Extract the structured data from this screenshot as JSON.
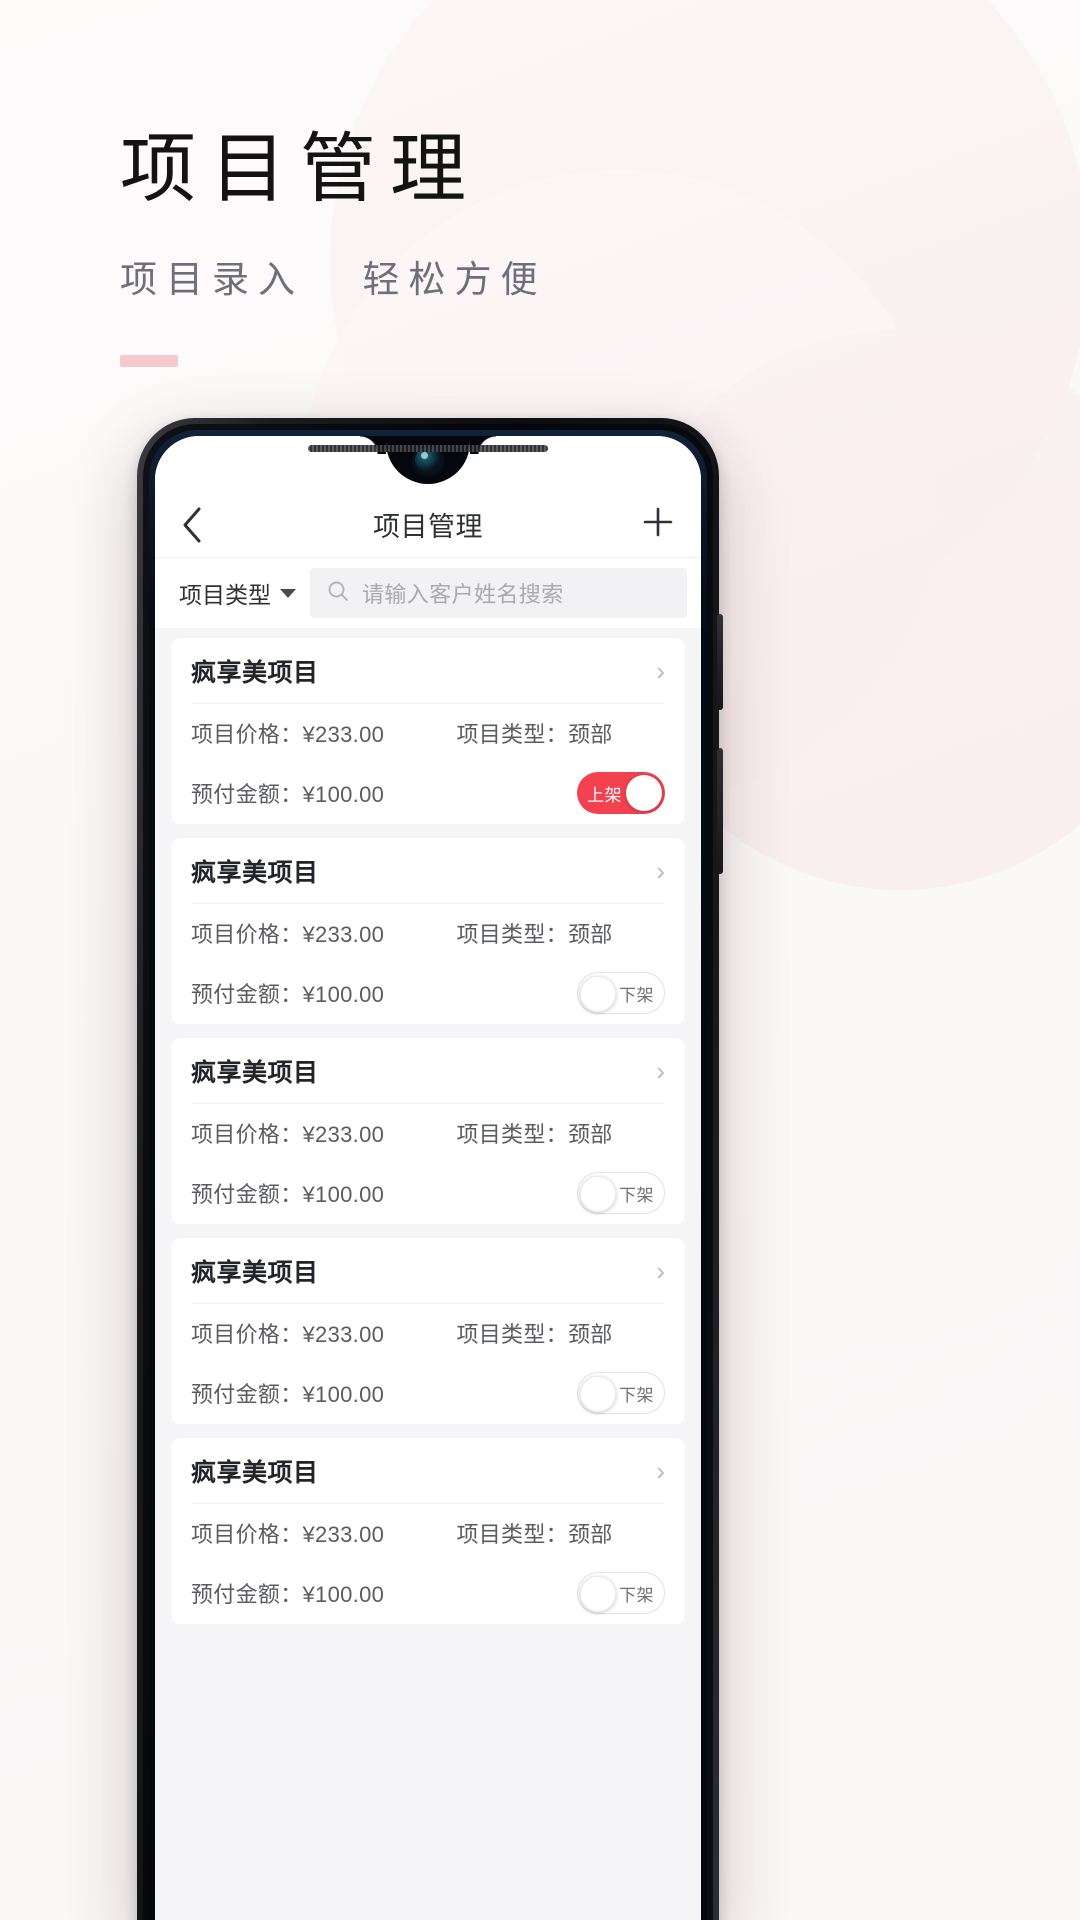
{
  "promo": {
    "headline": "项目管理",
    "subhead_left": "项目录入",
    "subhead_right": "轻松方便",
    "accent_color": "#f6c9cf"
  },
  "app": {
    "navbar": {
      "back_icon": "chevron-left-icon",
      "title": "项目管理",
      "add_icon": "plus-icon"
    },
    "filterbar": {
      "type_filter_label": "项目类型",
      "type_filter_caret": "chevron-down-icon",
      "search_icon": "search-icon",
      "search_placeholder": "请输入客户姓名搜索",
      "search_value": ""
    },
    "labels": {
      "price": "项目价格：",
      "type": "项目类型：",
      "prepay": "预付金额：",
      "chevron": "›"
    },
    "accent_on_color": "#f2414f",
    "cards": [
      {
        "title": "疯享美项目",
        "price": "¥233.00",
        "type": "颈部",
        "prepay": "¥100.00",
        "status_label": "上架",
        "status_on": true
      },
      {
        "title": "疯享美项目",
        "price": "¥233.00",
        "type": "颈部",
        "prepay": "¥100.00",
        "status_label": "下架",
        "status_on": false
      },
      {
        "title": "疯享美项目",
        "price": "¥233.00",
        "type": "颈部",
        "prepay": "¥100.00",
        "status_label": "下架",
        "status_on": false
      },
      {
        "title": "疯享美项目",
        "price": "¥233.00",
        "type": "颈部",
        "prepay": "¥100.00",
        "status_label": "下架",
        "status_on": false
      },
      {
        "title": "疯享美项目",
        "price": "¥233.00",
        "type": "颈部",
        "prepay": "¥100.00",
        "status_label": "下架",
        "status_on": false
      }
    ]
  }
}
